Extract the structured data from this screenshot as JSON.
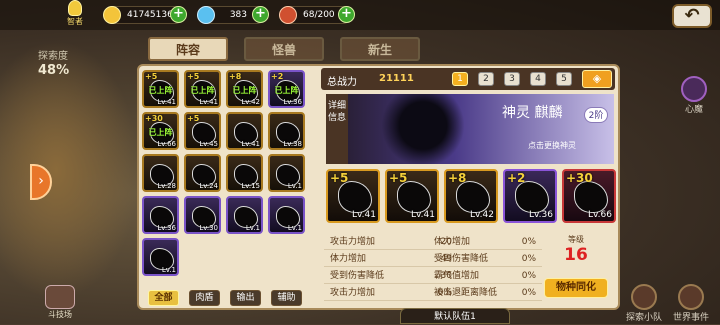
{
  "top": {
    "title": "智者",
    "gold": "41745136",
    "gems": "383",
    "stamina": "68/200"
  },
  "left": {
    "explore_label": "探索度",
    "explore_pct": "48%",
    "arena": "斗技场"
  },
  "right": {
    "heart": "心魔",
    "explore_team": "探索小队",
    "world_event": "世界事件"
  },
  "tabs": [
    "阵容",
    "怪兽",
    "新生"
  ],
  "roster": [
    {
      "plus": "+5",
      "lv": "Lv.41",
      "deployed": "已上阵",
      "color": "gold"
    },
    {
      "plus": "+5",
      "lv": "Lv.41",
      "deployed": "已上阵",
      "color": "gold"
    },
    {
      "plus": "+8",
      "lv": "Lv.42",
      "deployed": "已上阵",
      "color": "gold"
    },
    {
      "plus": "+2",
      "lv": "Lv.36",
      "deployed": "已上阵",
      "color": "purple"
    },
    {
      "plus": "+30",
      "lv": "Lv.66",
      "deployed": "已上阵",
      "color": "gold"
    },
    {
      "plus": "+5",
      "lv": "Lv.45",
      "deployed": "",
      "color": "gold"
    },
    {
      "plus": "",
      "lv": "Lv.41",
      "deployed": "",
      "color": "gold"
    },
    {
      "plus": "",
      "lv": "Lv.38",
      "deployed": "",
      "color": "gold"
    },
    {
      "plus": "",
      "lv": "Lv.28",
      "deployed": "",
      "color": "gold"
    },
    {
      "plus": "",
      "lv": "Lv.24",
      "deployed": "",
      "color": "gold"
    },
    {
      "plus": "",
      "lv": "Lv.15",
      "deployed": "",
      "color": "gold"
    },
    {
      "plus": "",
      "lv": "Lv.1",
      "deployed": "",
      "color": "gold"
    },
    {
      "plus": "",
      "lv": "Lv.36",
      "deployed": "",
      "color": "purple"
    },
    {
      "plus": "",
      "lv": "Lv.30",
      "deployed": "",
      "color": "purple"
    },
    {
      "plus": "",
      "lv": "Lv.1",
      "deployed": "",
      "color": "purple"
    },
    {
      "plus": "",
      "lv": "Lv.1",
      "deployed": "",
      "color": "purple"
    },
    {
      "plus": "",
      "lv": "Lv.1",
      "deployed": "",
      "color": "purple"
    }
  ],
  "filters": [
    "全部",
    "肉盾",
    "输出",
    "辅助"
  ],
  "power": {
    "label": "总战力",
    "value": "21111",
    "slots": [
      "1",
      "2",
      "3",
      "4",
      "5"
    ]
  },
  "detail": {
    "side": "详细信息",
    "name": "神灵 麒麟",
    "rank": "2阶",
    "sub": "点击更换神灵"
  },
  "team": [
    {
      "plus": "+5",
      "lv": "Lv.41",
      "color": "gold"
    },
    {
      "plus": "+5",
      "lv": "Lv.41",
      "color": "gold"
    },
    {
      "plus": "+8",
      "lv": "Lv.42",
      "color": "gold"
    },
    {
      "plus": "+2",
      "lv": "Lv.36",
      "color": "purple"
    },
    {
      "plus": "+30",
      "lv": "Lv.66",
      "color": "red"
    }
  ],
  "stats": [
    [
      "攻击力增加",
      "20",
      "体力增加",
      "0%"
    ],
    [
      "体力增加",
      "49",
      "受到伤害降低",
      "0%"
    ],
    [
      "受到伤害降低",
      "30",
      "霸气值增加",
      "0%"
    ],
    [
      "攻击力增加",
      "0%",
      "被击退距离降低",
      "0%"
    ]
  ],
  "level": {
    "label": "等级",
    "value": "16"
  },
  "sync": "物种同化",
  "team_name": "默认队伍1"
}
